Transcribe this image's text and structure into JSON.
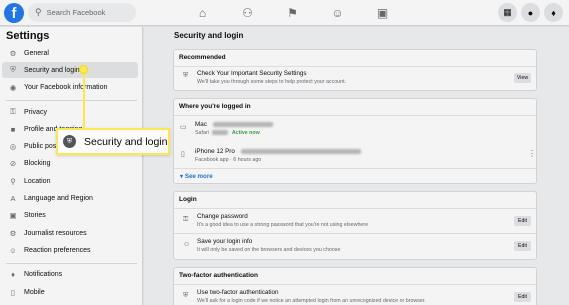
{
  "topbar": {
    "logo": "f",
    "search_placeholder": "Search Facebook"
  },
  "sidebar": {
    "title": "Settings",
    "items": [
      {
        "label": "General",
        "icon": "gear-icon"
      },
      {
        "label": "Security and login",
        "icon": "shield-icon"
      },
      {
        "label": "Your Facebook information",
        "icon": "facebook-icon"
      },
      {
        "label": "Privacy",
        "icon": "lock-icon"
      },
      {
        "label": "Profile and tagging",
        "icon": "tag-icon"
      },
      {
        "label": "Public posts",
        "icon": "globe-icon"
      },
      {
        "label": "Blocking",
        "icon": "block-icon"
      },
      {
        "label": "Location",
        "icon": "location-icon"
      },
      {
        "label": "Language and Region",
        "icon": "language-icon"
      },
      {
        "label": "Stories",
        "icon": "stories-icon"
      },
      {
        "label": "Journalist resources",
        "icon": "journalist-icon"
      },
      {
        "label": "Reaction preferences",
        "icon": "reaction-icon"
      },
      {
        "label": "Notifications",
        "icon": "bell-icon"
      },
      {
        "label": "Mobile",
        "icon": "mobile-icon"
      }
    ]
  },
  "main": {
    "title": "Security and login",
    "recommended": {
      "header": "Recommended",
      "item_title": "Check Your Important Security Settings",
      "item_sub": "We'll take you through some steps to help protect your account.",
      "button": "View"
    },
    "logged_in": {
      "header": "Where you're logged in",
      "device1_name": "Mac",
      "device1_sub_app": "Safari",
      "device1_status": "Active now",
      "device2_name": "iPhone 12 Pro",
      "device2_sub": "Facebook app · 6 hours ago",
      "see_more": "See more"
    },
    "login": {
      "header": "Login",
      "change_title": "Change password",
      "change_sub": "It's a good idea to use a strong password that you're not using elsewhere",
      "save_title": "Save your login info",
      "save_sub": "It will only be saved on the browsers and devices you choose",
      "edit": "Edit"
    },
    "two_factor": {
      "header": "Two-factor authentication",
      "item_title": "Use two-factor authentication",
      "item_sub": "We'll ask for a login code if we notice an attempted login from an unrecognized device or browser.",
      "edit": "Edit"
    }
  },
  "callout": {
    "label": "Security and login"
  },
  "colors": {
    "accent": "#1877f2",
    "highlight": "#fde94d",
    "active_green": "#31a24c"
  }
}
